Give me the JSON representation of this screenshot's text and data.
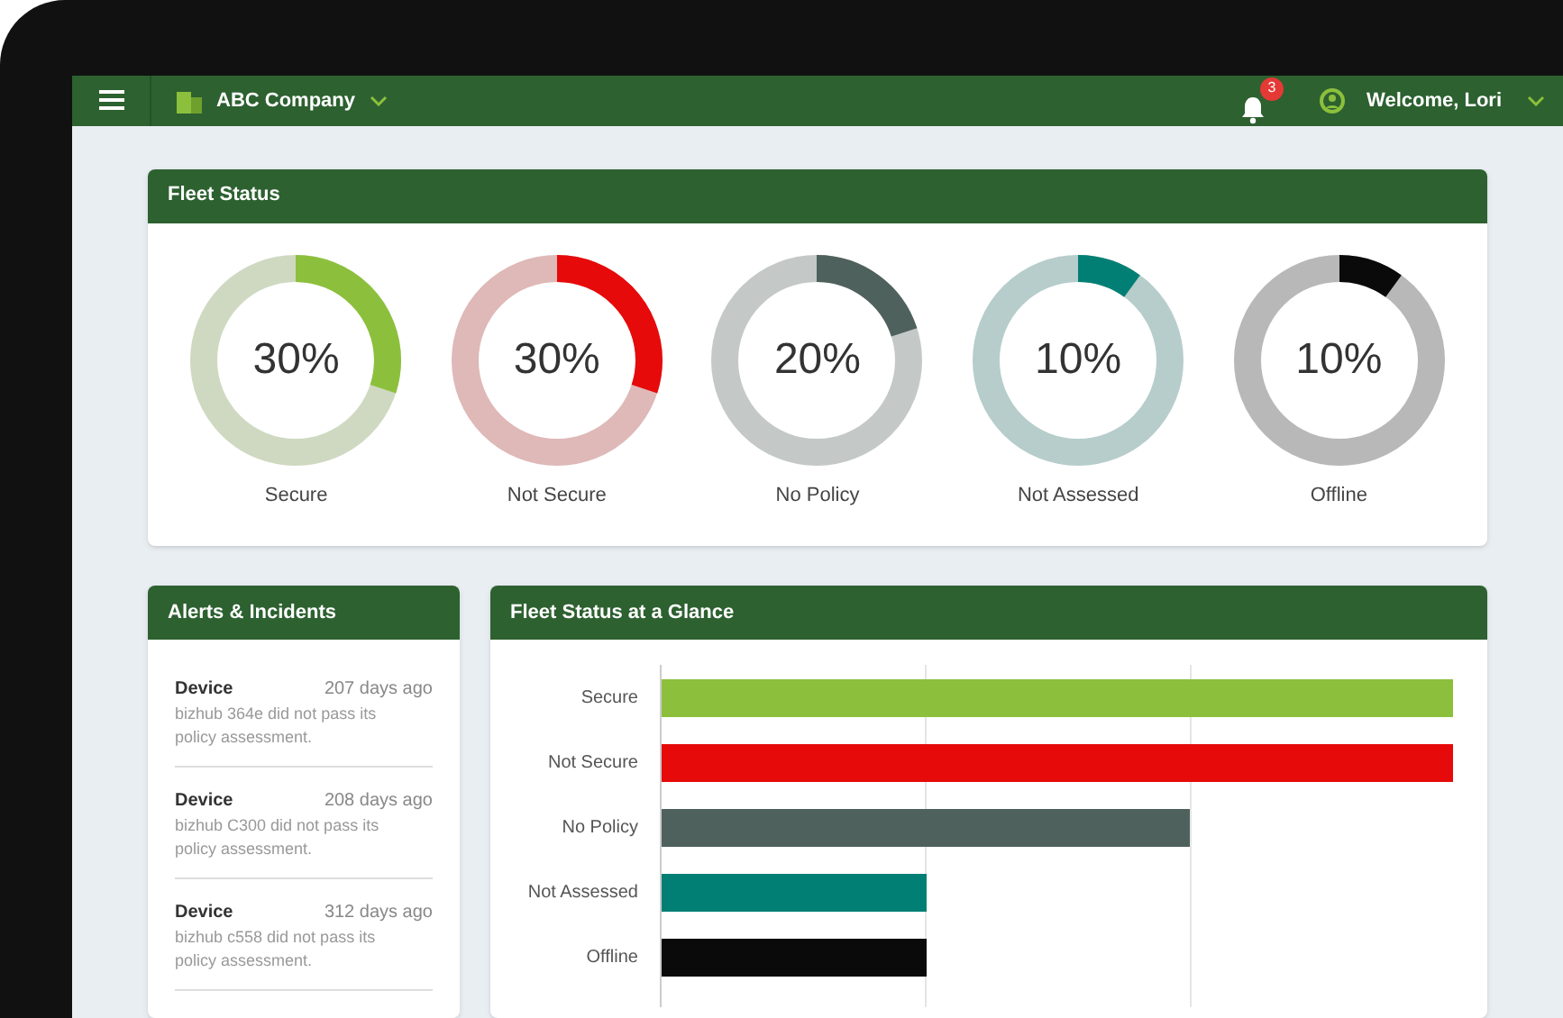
{
  "header": {
    "company": "ABC Company",
    "notifications": "3",
    "welcome": "Welcome, Lori"
  },
  "fleet_status": {
    "title": "Fleet Status",
    "items": [
      {
        "label": "Secure",
        "value": "30%",
        "level": 0.3,
        "color": "#8cc03c"
      },
      {
        "label": "Not Secure",
        "value": "30%",
        "level": 0.3,
        "color": "#e60a0a"
      },
      {
        "label": "No Policy",
        "value": "20%",
        "level": 0.2,
        "color": "#4f615c"
      },
      {
        "label": "Not Assessed",
        "value": "10%",
        "level": 0.1,
        "color": "#027f74"
      },
      {
        "label": "Offline",
        "value": "10%",
        "level": 0.1,
        "color": "#0a0a0a"
      }
    ]
  },
  "alerts": {
    "title": "Alerts & Incidents",
    "items": [
      {
        "type": "Device",
        "time": "207 days ago",
        "message": "bizhub 364e did not pass its policy assessment."
      },
      {
        "type": "Device",
        "time": "208 days ago",
        "message": "bizhub C300 did not pass its policy assessment."
      },
      {
        "type": "Device",
        "time": "312 days ago",
        "message": "bizhub c558 did not pass its policy assessment."
      }
    ]
  },
  "glance": {
    "title": "Fleet Status at a Glance",
    "labels": [
      "Secure",
      "Not Secure",
      "No Policy",
      "Not Assessed",
      "Offline"
    ]
  }
}
